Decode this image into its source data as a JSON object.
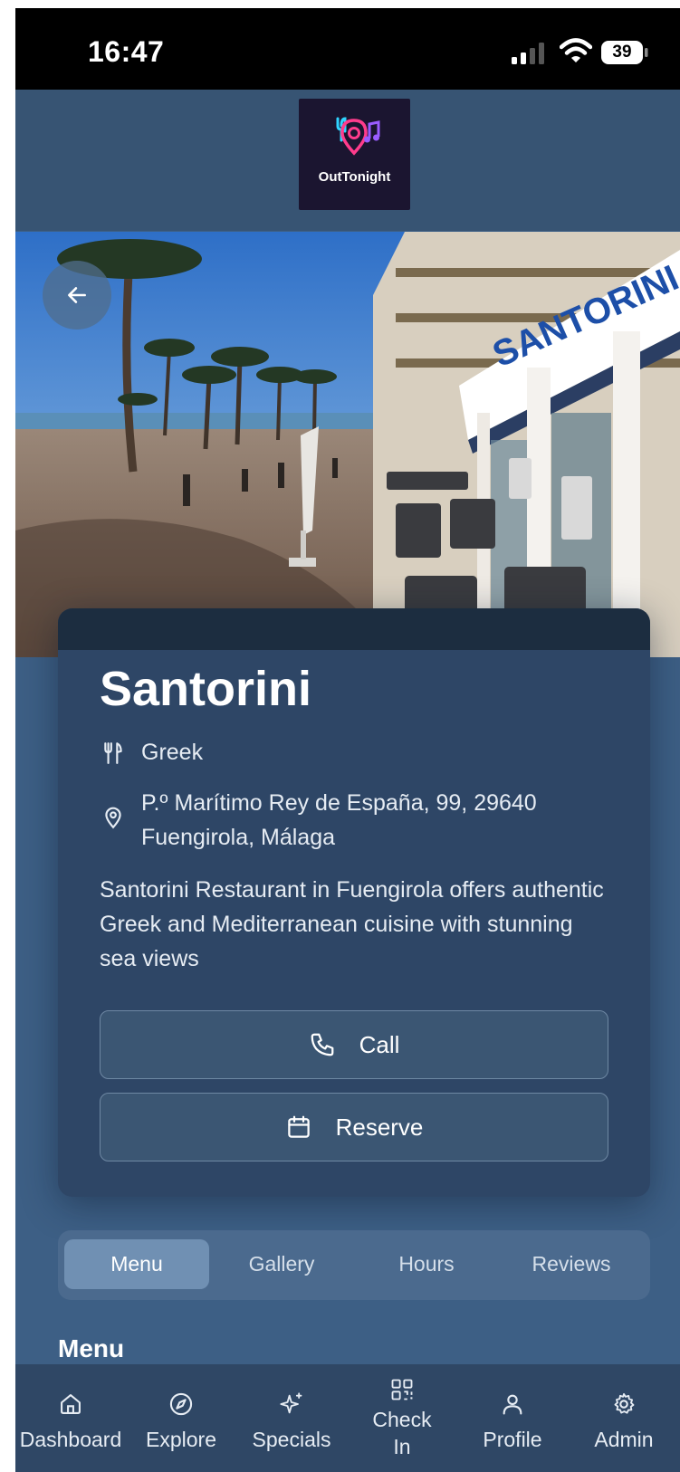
{
  "status_bar": {
    "time": "16:47",
    "battery": "39"
  },
  "header": {
    "logo_text": "OutTonight"
  },
  "venue": {
    "name": "Santorini",
    "cuisine": "Greek",
    "address_line1": "P.º Marítimo Rey de España, 99, 29640",
    "address_line2": "Fuengirola, Málaga",
    "description": "Santorini Restaurant in Fuengirola offers authentic Greek and Mediterranean cuisine with stunning sea views",
    "sign_text": "SANTORINI"
  },
  "actions": {
    "call_label": "Call",
    "reserve_label": "Reserve"
  },
  "tabs": [
    {
      "label": "Menu",
      "active": true
    },
    {
      "label": "Gallery",
      "active": false
    },
    {
      "label": "Hours",
      "active": false
    },
    {
      "label": "Reviews",
      "active": false
    }
  ],
  "section": {
    "title": "Menu"
  },
  "nav": [
    {
      "label": "Dashboard",
      "icon": "home-icon"
    },
    {
      "label": "Explore",
      "icon": "compass-icon"
    },
    {
      "label": "Specials",
      "icon": "sparkles-icon"
    },
    {
      "label": "Check In",
      "icon": "qr-code-icon"
    },
    {
      "label": "Profile",
      "icon": "user-icon"
    },
    {
      "label": "Admin",
      "icon": "gear-icon"
    }
  ],
  "colors": {
    "background": "#3d5f85",
    "card": "#2e4666",
    "header": "#375473",
    "nav": "#2f4765",
    "tab_active": "#7090b3"
  }
}
